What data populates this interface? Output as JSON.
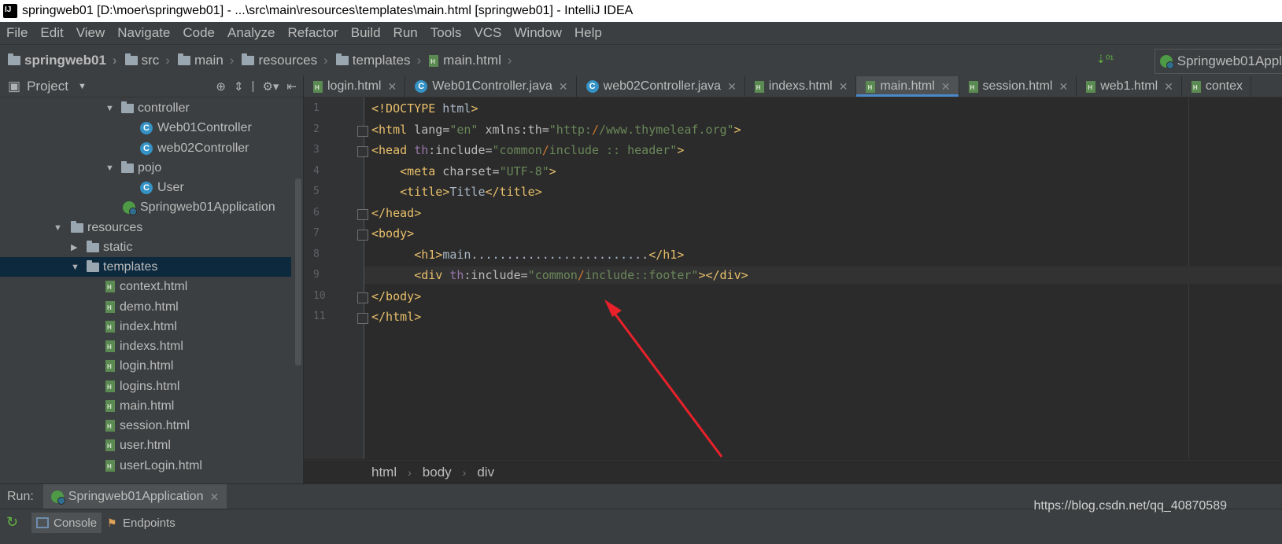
{
  "window": {
    "title": "springweb01 [D:\\moer\\springweb01] - ...\\src\\main\\resources\\templates\\main.html [springweb01] - IntelliJ IDEA"
  },
  "menu": [
    "File",
    "Edit",
    "View",
    "Navigate",
    "Code",
    "Analyze",
    "Refactor",
    "Build",
    "Run",
    "Tools",
    "VCS",
    "Window",
    "Help"
  ],
  "breadcrumb": [
    "springweb01",
    "src",
    "main",
    "resources",
    "templates",
    "main.html"
  ],
  "run_config": {
    "label": "Springweb01Appl"
  },
  "project_panel": {
    "title": "Project",
    "tree": [
      {
        "label": "controller",
        "type": "folder",
        "expanded": true
      },
      {
        "label": "Web01Controller",
        "type": "class"
      },
      {
        "label": "web02Controller",
        "type": "class"
      },
      {
        "label": "pojo",
        "type": "folder",
        "expanded": true
      },
      {
        "label": "User",
        "type": "class"
      },
      {
        "label": "Springweb01Application",
        "type": "spring"
      },
      {
        "label": "resources",
        "type": "folder",
        "expanded": true
      },
      {
        "label": "static",
        "type": "folder",
        "expanded": false
      },
      {
        "label": "templates",
        "type": "folder",
        "expanded": true,
        "selected": true
      },
      {
        "label": "context.html",
        "type": "html"
      },
      {
        "label": "demo.html",
        "type": "html"
      },
      {
        "label": "index.html",
        "type": "html"
      },
      {
        "label": "indexs.html",
        "type": "html"
      },
      {
        "label": "login.html",
        "type": "html"
      },
      {
        "label": "logins.html",
        "type": "html"
      },
      {
        "label": "main.html",
        "type": "html"
      },
      {
        "label": "session.html",
        "type": "html"
      },
      {
        "label": "user.html",
        "type": "html"
      },
      {
        "label": "userLogin.html",
        "type": "html"
      }
    ]
  },
  "tabs": [
    {
      "label": "login.html",
      "type": "html"
    },
    {
      "label": "Web01Controller.java",
      "type": "class"
    },
    {
      "label": "web02Controller.java",
      "type": "class"
    },
    {
      "label": "indexs.html",
      "type": "html"
    },
    {
      "label": "main.html",
      "type": "html",
      "active": true
    },
    {
      "label": "session.html",
      "type": "html"
    },
    {
      "label": "web1.html",
      "type": "html"
    },
    {
      "label": "contex",
      "type": "html"
    }
  ],
  "code": {
    "line_numbers": [
      "1",
      "2",
      "3",
      "4",
      "5",
      "6",
      "7",
      "8",
      "9",
      "10",
      "11"
    ],
    "lines": [
      "<!DOCTYPE html>",
      "<html lang=\"en\" xmlns:th=\"http://www.thymeleaf.org\">",
      "<head th:include=\"common/include :: header\">",
      "    <meta charset=\"UTF-8\">",
      "    <title>Title</title>",
      "</head>",
      "<body>",
      "      <h1>main.........................</h1>",
      "      <div th:include=\"common/include::footer\"></div>",
      "</body>",
      "</html>"
    ]
  },
  "editor_breadcrumb": [
    "html",
    "body",
    "div"
  ],
  "run_panel": {
    "label": "Run:",
    "tab": "Springweb01Application",
    "subtabs": [
      "Console",
      "Endpoints"
    ]
  },
  "watermark": "https://blog.csdn.net/qq_40870589",
  "colors": {
    "accent": "#4a88c7",
    "arrow": "#e8212b",
    "selection": "#0d293e"
  }
}
